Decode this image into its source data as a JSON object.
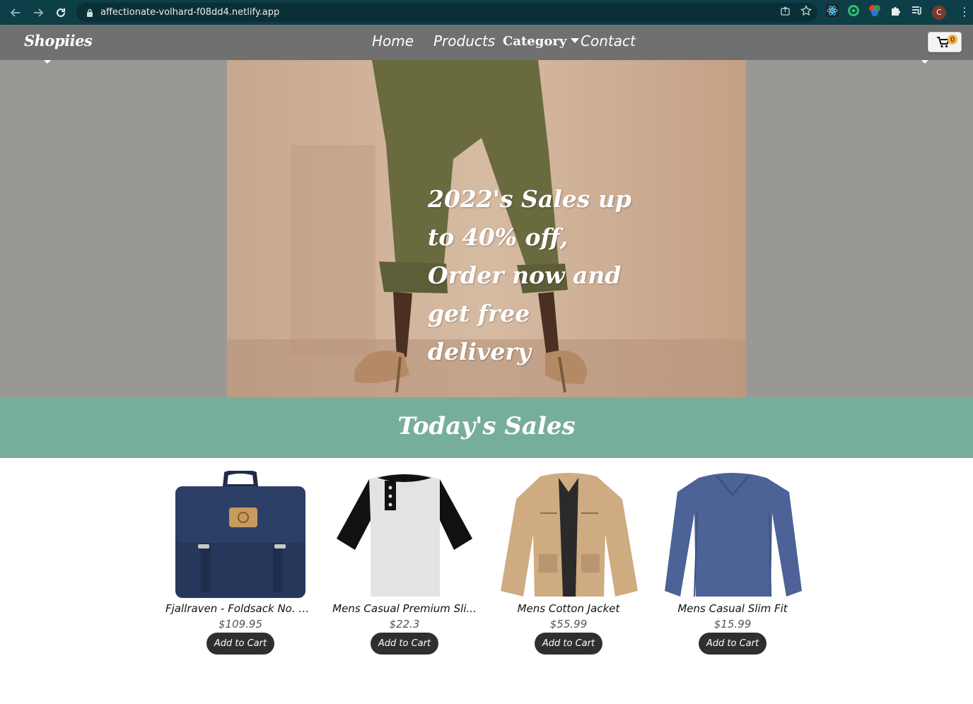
{
  "browser": {
    "url": "affectionate-volhard-f08dd4.netlify.app",
    "profile_initial": "C",
    "icons": [
      "back-icon",
      "forward-icon",
      "reload-icon",
      "lock-icon",
      "share-icon",
      "star-icon",
      "react-devtools-icon",
      "extension-green-icon",
      "color-picker-icon",
      "puzzle-icon",
      "media-queue-icon",
      "more-icon"
    ]
  },
  "site": {
    "brand": "Shopiies",
    "nav": {
      "home": "Home",
      "products": "Products",
      "category": "Category",
      "contact": "Contact"
    },
    "cart_count": "0"
  },
  "hero": {
    "title": "2022's Sales up to 40% off, Order now and get free delivery"
  },
  "sales": {
    "heading": "Today's Sales"
  },
  "products": [
    {
      "name": "Fjallraven - Foldsack No. 1...",
      "price": "$109.95",
      "button": "Add to Cart"
    },
    {
      "name": "Mens Casual Premium Sli...",
      "price": "$22.3",
      "button": "Add to Cart"
    },
    {
      "name": "Mens Cotton Jacket",
      "price": "$55.99",
      "button": "Add to Cart"
    },
    {
      "name": "Mens Casual Slim Fit",
      "price": "$15.99",
      "button": "Add to Cart"
    }
  ],
  "colors": {
    "chrome": "#0e3e47",
    "navbar": "#707070",
    "hero_bg": "#9a9895",
    "sales_banner": "#77ae9a",
    "button": "#2f2f2f",
    "cart_badge": "#f3b247"
  }
}
